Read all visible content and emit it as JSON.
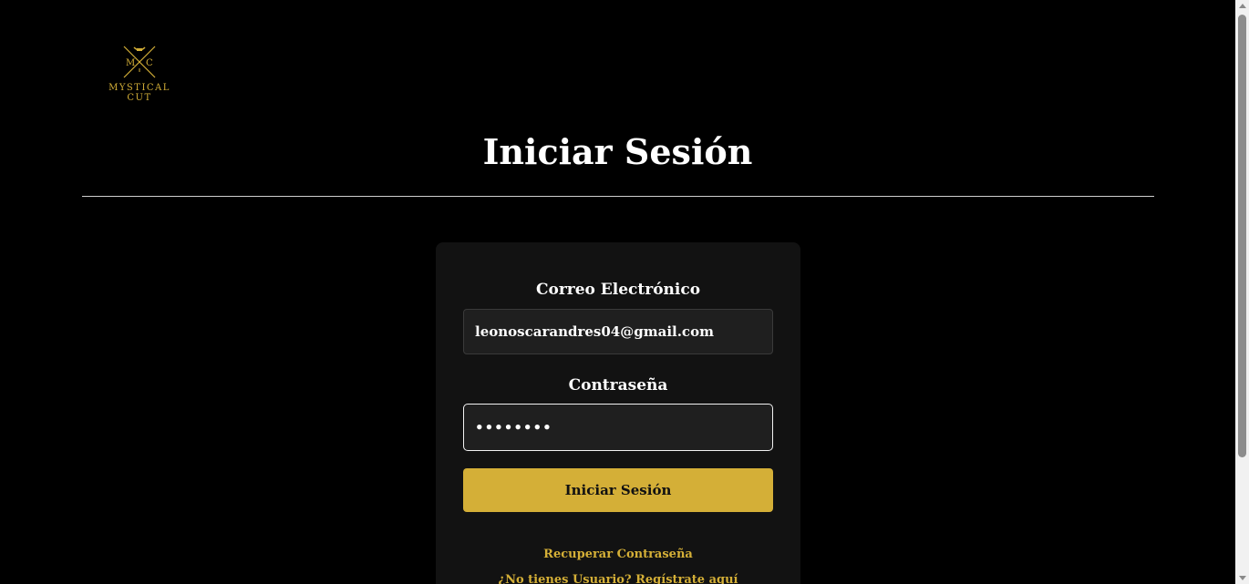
{
  "brand": {
    "logo_initials_left": "M",
    "logo_initials_right": "C",
    "logo_line1": "MYSTICAL",
    "logo_line2": "CUT",
    "accent_color": "#d4af37"
  },
  "page": {
    "title": "Iniciar Sesión"
  },
  "login_form": {
    "email_label": "Correo Electrónico",
    "email_value": "leonoscarandres04@gmail.com",
    "password_label": "Contraseña",
    "password_value": "••••••••",
    "submit_label": "Iniciar Sesión",
    "recover_link": "Recuperar Contraseña",
    "register_link": "¿No tienes Usuario? Regístrate aquí"
  },
  "colors": {
    "background": "#000000",
    "card_background": "#121212",
    "button_background": "#d4af37"
  }
}
